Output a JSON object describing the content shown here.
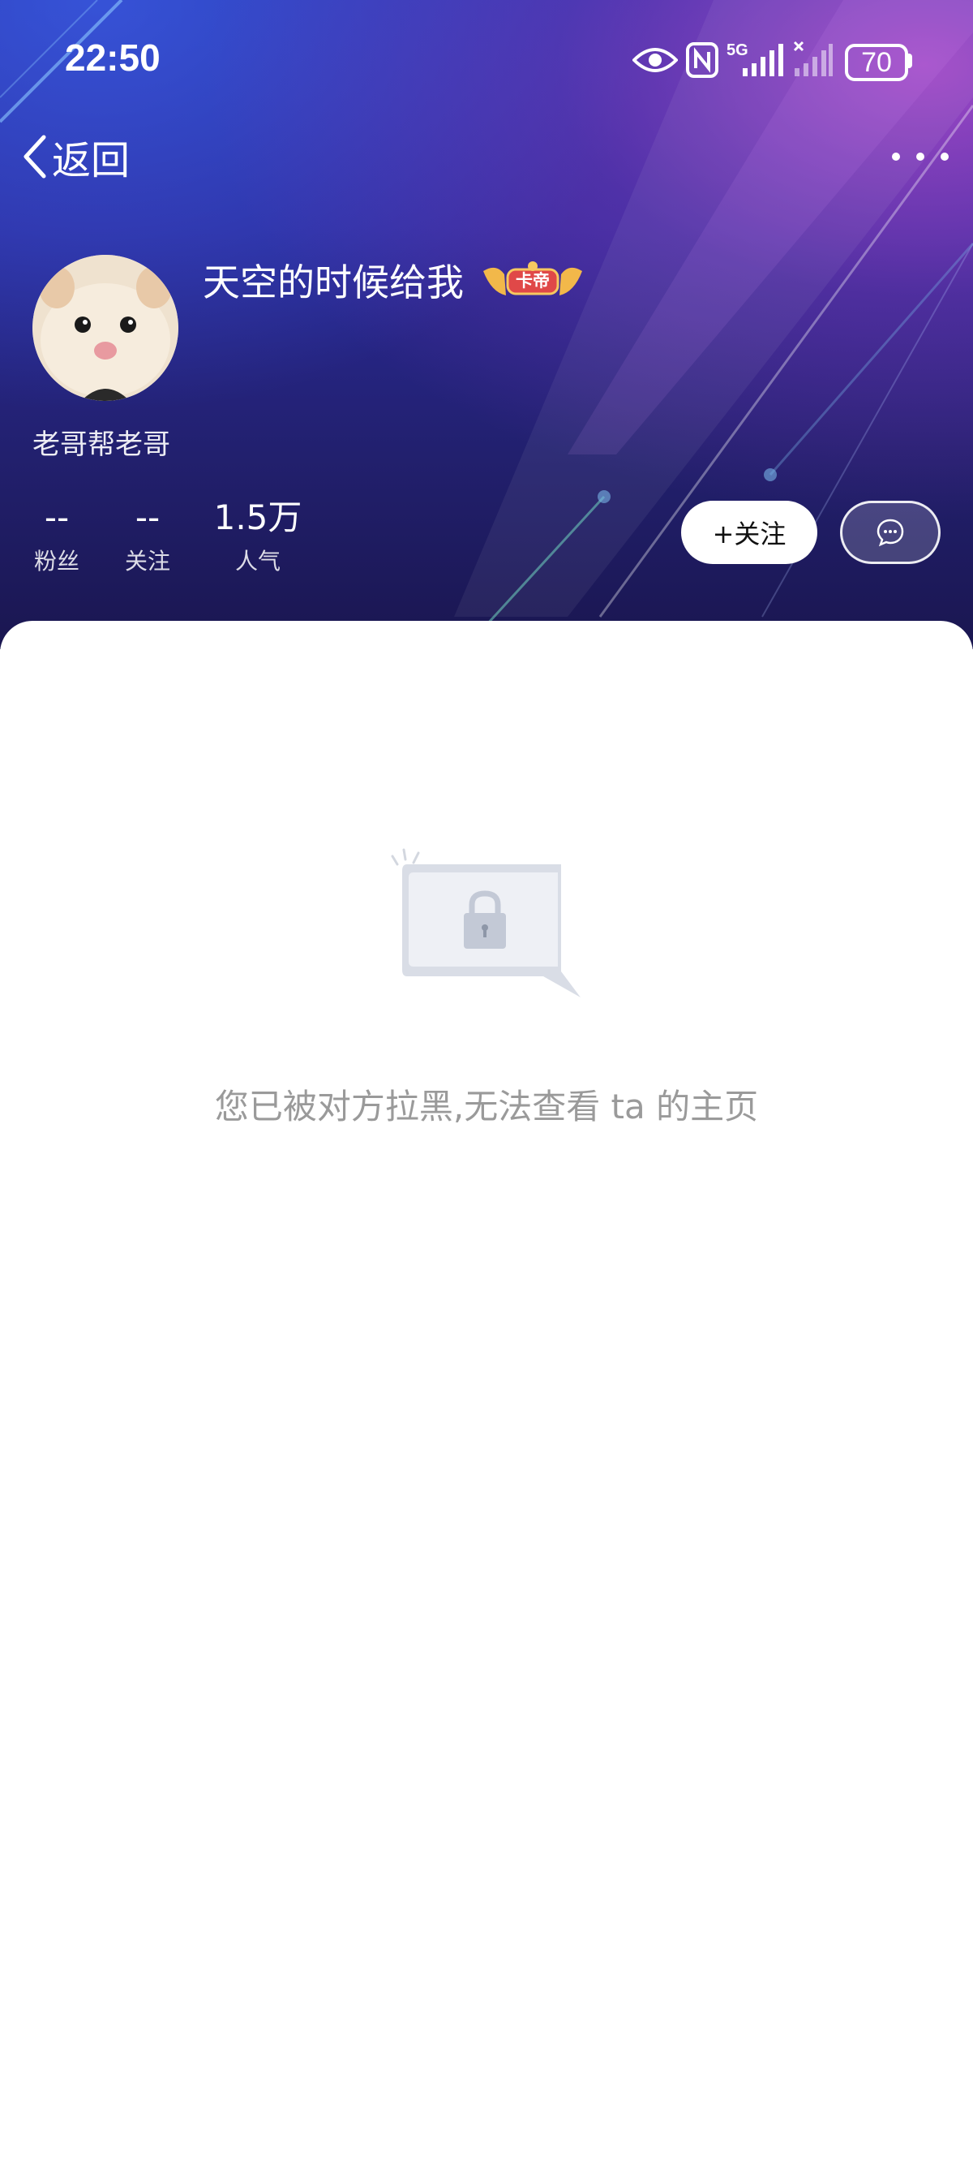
{
  "status_bar": {
    "time": "22:50",
    "battery": "70",
    "icons": [
      "eye-icon",
      "nfc-icon",
      "5g-signal-icon",
      "signal-x-icon",
      "battery-icon"
    ]
  },
  "nav": {
    "back_label": "返回",
    "more_icon": "more-dots-icon"
  },
  "profile": {
    "username": "天空的时候给我",
    "badge_text": "卡帝",
    "signature": "老哥帮老哥",
    "stats": [
      {
        "value": "--",
        "label": "粉丝"
      },
      {
        "value": "--",
        "label": "关注"
      },
      {
        "value": "1.5万",
        "label": "人气"
      }
    ],
    "follow_label": "+关注",
    "message_icon": "chat-bubble-icon"
  },
  "content": {
    "empty_message": "您已被对方拉黑,无法查看 ta 的主页",
    "illustration_icon": "lock-icon"
  },
  "colors": {
    "header_top": "#2431a6",
    "header_bottom": "#1a1650",
    "accent_pink": "#c850d2",
    "empty_text": "#9a9a9a"
  }
}
